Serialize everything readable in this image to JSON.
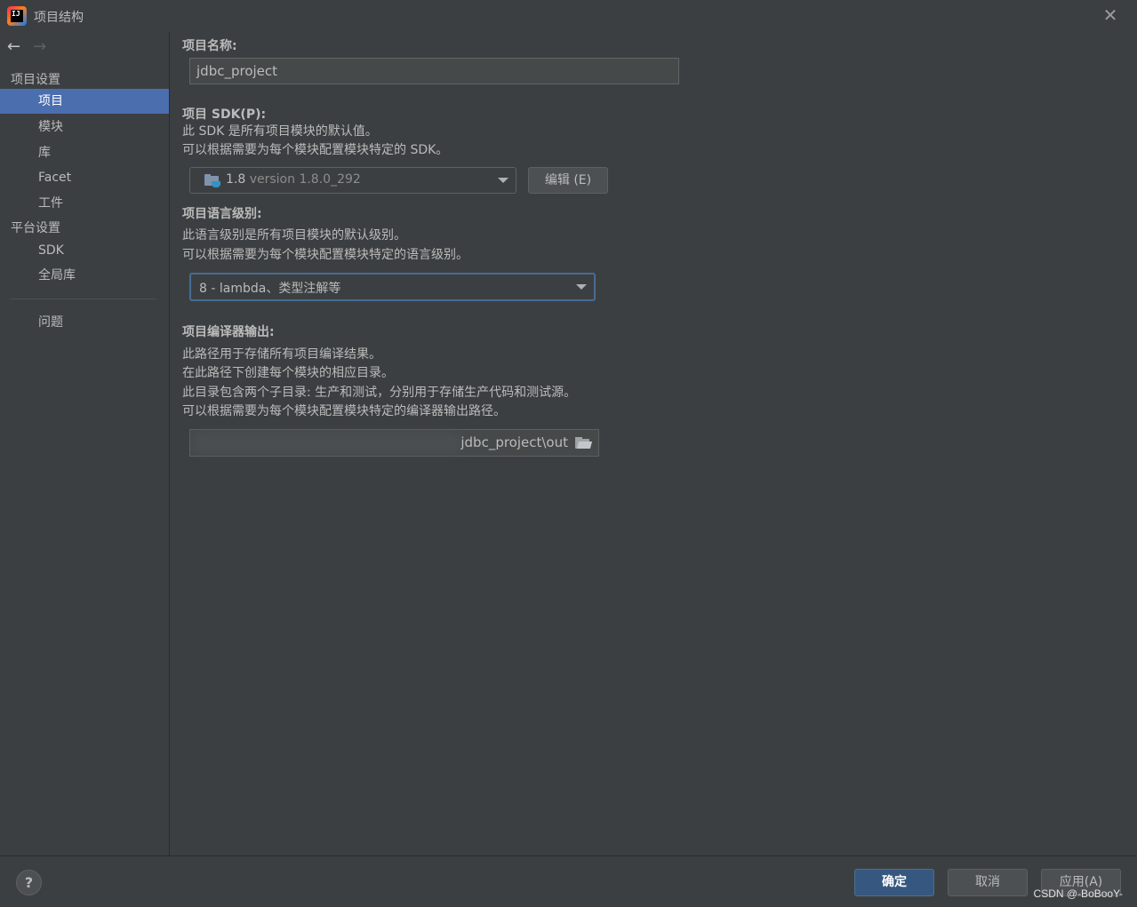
{
  "window": {
    "title": "项目结构",
    "close_glyph": "✕"
  },
  "nav": {
    "back_glyph": "←",
    "forward_glyph": "→"
  },
  "sidebar": {
    "project_settings_header": "项目设置",
    "platform_settings_header": "平台设置",
    "items": [
      {
        "label": "项目",
        "selected": true
      },
      {
        "label": "模块"
      },
      {
        "label": "库"
      },
      {
        "label": "Facet"
      },
      {
        "label": "工件"
      }
    ],
    "platform_items": [
      {
        "label": "SDK"
      },
      {
        "label": "全局库"
      }
    ],
    "problems_label": "问题"
  },
  "main": {
    "project_name": {
      "label": "项目名称:",
      "value": "jdbc_project"
    },
    "sdk": {
      "label": "项目 SDK(P):",
      "desc1": "此 SDK 是所有项目模块的默认值。",
      "desc2": "可以根据需要为每个模块配置模块特定的 SDK。",
      "version": "1.8",
      "version_detail": "version 1.8.0_292",
      "edit_button": "编辑 (E)"
    },
    "language_level": {
      "label": "项目语言级别:",
      "desc1": "此语言级别是所有项目模块的默认级别。",
      "desc2": "可以根据需要为每个模块配置模块特定的语言级别。",
      "value": "8 - lambda、类型注解等"
    },
    "compiler_output": {
      "label": "项目编译器输出:",
      "desc1": "此路径用于存储所有项目编译结果。",
      "desc2": "在此路径下创建每个模块的相应目录。",
      "desc3": "此目录包含两个子目录: 生产和测试，分别用于存储生产代码和测试源。",
      "desc4": "可以根据需要为每个模块配置模块特定的编译器输出路径。",
      "path": "jdbc_project\\out"
    }
  },
  "footer": {
    "help": "?",
    "ok": "确定",
    "cancel": "取消",
    "apply": "应用(A)",
    "watermark": "CSDN @-BoBooY-"
  },
  "colors": {
    "background": "#3c3f41",
    "selection": "#4b6eaf",
    "primary_button": "#365880",
    "focus_border": "#466d94"
  }
}
